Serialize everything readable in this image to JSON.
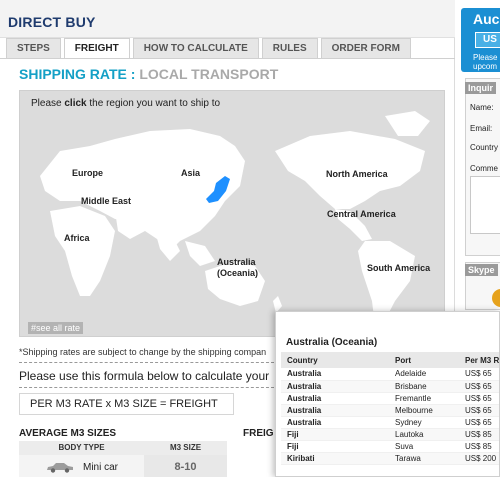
{
  "header": {
    "title": "DIRECT BUY"
  },
  "tabs": [
    {
      "label": "STEPS"
    },
    {
      "label": "FREIGHT"
    },
    {
      "label": "HOW TO CALCULATE"
    },
    {
      "label": "RULES"
    },
    {
      "label": "ORDER FORM"
    }
  ],
  "active_tab": "FREIGHT",
  "heading": {
    "main": "SHIPPING RATE :",
    "sub": "LOCAL TRANSPORT"
  },
  "map": {
    "prompt_before": "Please ",
    "prompt_bold": "click",
    "prompt_after": " the region you want to ship to",
    "regions": [
      {
        "label": "Europe"
      },
      {
        "label": "Asia"
      },
      {
        "label": "North America"
      },
      {
        "label": "Middle East"
      },
      {
        "label": "Central America"
      },
      {
        "label": "Africa"
      },
      {
        "label": "Australia"
      },
      {
        "label": "(Oceania)"
      },
      {
        "label": "South America"
      }
    ],
    "see_all": "#see all rate",
    "land_color": "#ffffff",
    "sea_color": "#dcdcdc",
    "highlight_color": "#1e90ff"
  },
  "note": "*Shipping rates are subject to change by the shipping compan",
  "formula": {
    "intro": "Please use this formula below to calculate your",
    "text": "PER M3 RATE  x  M3 SIZE = FREIGHT"
  },
  "avg_sizes": {
    "title": "AVERAGE M3 SIZES",
    "headers": [
      "BODY TYPE",
      "M3 SIZE"
    ],
    "rows": [
      {
        "body_type": "Mini car",
        "size": "8-10",
        "icon": "car-icon"
      }
    ]
  },
  "freight_title": "FREIG",
  "sidebar": {
    "auction_title": "Auc",
    "auction_button": "US",
    "auction_note_1": "Please",
    "auction_note_2": "upcom",
    "inquiry_title": "Inquir",
    "inquiry_fields": [
      "Name:",
      "Email:",
      "Country",
      "Comme"
    ],
    "skype_title": "Skype"
  },
  "popup": {
    "title": "Australia (Oceania)",
    "headers": [
      "Country",
      "Port",
      "Per M3 R"
    ],
    "rows": [
      {
        "country": "Australia",
        "port": "Adelaide",
        "rate": "US$ 65"
      },
      {
        "country": "Australia",
        "port": "Brisbane",
        "rate": "US$ 65"
      },
      {
        "country": "Australia",
        "port": "Fremantle",
        "rate": "US$ 65"
      },
      {
        "country": "Australia",
        "port": "Melbourne",
        "rate": "US$ 65"
      },
      {
        "country": "Australia",
        "port": "Sydney",
        "rate": "US$ 65"
      },
      {
        "country": "Fiji",
        "port": "Lautoka",
        "rate": "US$ 85"
      },
      {
        "country": "Fiji",
        "port": "Suva",
        "rate": "US$ 85"
      },
      {
        "country": "Kiribati",
        "port": "Tarawa",
        "rate": "US$ 200"
      }
    ]
  }
}
